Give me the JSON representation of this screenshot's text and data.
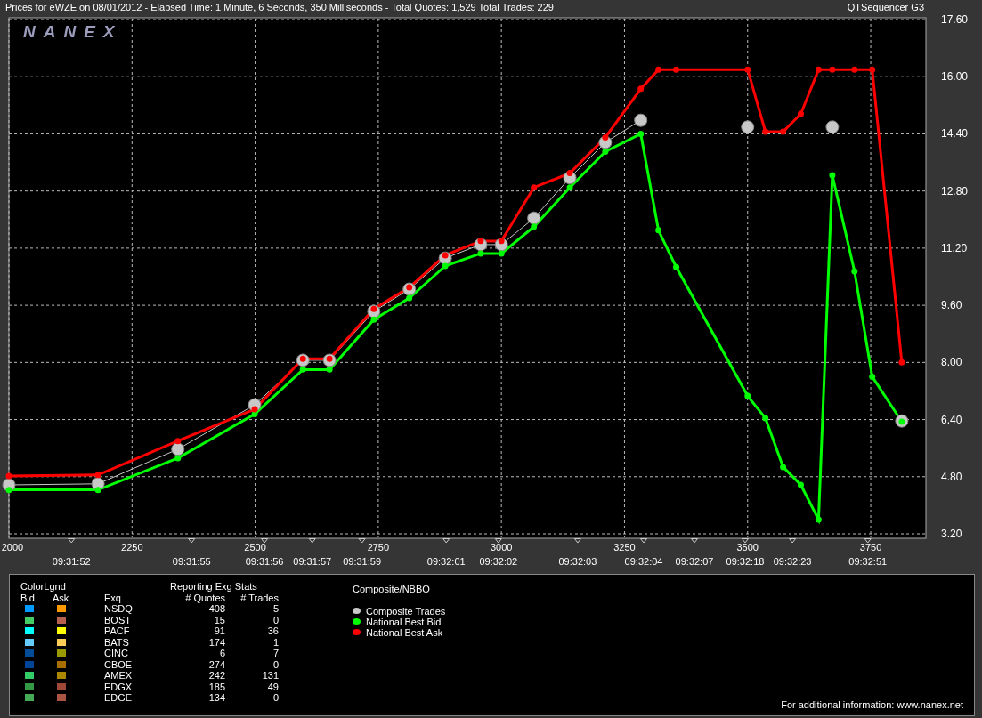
{
  "header": {
    "title": "Prices for  eWZE  on  08/01/2012  -  Elapsed Time: 1 Minute, 6 Seconds, 350 Milliseconds  -  Total Quotes: 1,529  Total Trades: 229",
    "app": "QTSequencer G3"
  },
  "chart": {
    "logo": "NANEX",
    "chart_data": {
      "type": "line",
      "grid": true,
      "xlim": [
        2000,
        3862
      ],
      "ylim": [
        3.2,
        17.6
      ],
      "xticks": [
        2000,
        2250,
        2500,
        2750,
        3000,
        3250,
        3500,
        3750
      ],
      "yticks": [
        {
          "value": 3.2,
          "label": "3.20"
        },
        {
          "value": 4.8,
          "label": "4.80"
        },
        {
          "value": 6.4,
          "label": "6.40"
        },
        {
          "value": 8,
          "label": "8.00"
        },
        {
          "value": 9.6,
          "label": "9.60"
        },
        {
          "value": 11.2,
          "label": "11.20"
        },
        {
          "value": 12.8,
          "label": "12.80"
        },
        {
          "value": 14.4,
          "label": "14.40"
        },
        {
          "value": 16,
          "label": "16.00"
        },
        {
          "value": 17.6,
          "label": "17.60"
        }
      ],
      "x": [
        2000,
        2181,
        2343,
        2499,
        2597,
        2651,
        2741,
        2813,
        2886,
        2958,
        3000,
        3066,
        3139,
        3211,
        3283,
        3319,
        3355,
        3500,
        3536,
        3572,
        3608,
        3644,
        3672,
        3717,
        3753,
        3813
      ],
      "series": [
        {
          "name": "Composite Trades",
          "color": "#c8c8c8",
          "marker": "circle",
          "values": [
            4.57,
            4.6,
            5.57,
            6.81,
            8.06,
            8.06,
            9.43,
            10.05,
            10.92,
            11.3,
            11.3,
            12.04,
            13.17,
            14.16,
            14.78,
            null,
            null,
            14.59,
            null,
            null,
            null,
            null,
            14.59,
            null,
            null,
            6.36
          ]
        },
        {
          "name": "National Best Bid",
          "color": "#00ff00",
          "marker": "circle",
          "values": [
            4.43,
            4.43,
            5.32,
            6.55,
            7.8,
            7.8,
            9.2,
            9.8,
            10.7,
            11.05,
            11.05,
            11.8,
            12.9,
            13.9,
            14.4,
            11.7,
            10.67,
            7.06,
            6.44,
            5.07,
            4.57,
            3.6,
            13.24,
            10.55,
            7.6,
            6.34
          ]
        },
        {
          "name": "National Best Ask",
          "color": "#ff0000",
          "marker": "circle",
          "values": [
            4.82,
            4.85,
            5.8,
            6.69,
            8.1,
            8.1,
            9.5,
            10.1,
            11.0,
            11.4,
            11.4,
            12.9,
            13.3,
            14.3,
            15.66,
            16.2,
            16.2,
            16.2,
            14.46,
            14.46,
            14.96,
            16.2,
            16.2,
            16.2,
            16.2,
            8.0
          ]
        }
      ],
      "annotations": [
        "09:31:52",
        "09:31:55",
        "09:31:56",
        "09:31:57",
        "09:31:59",
        "09:32:01",
        "09:32:02",
        "09:32:03",
        "09:32:04",
        "09:32:07",
        "09:32:18",
        "09:32:23",
        "09:32:51"
      ]
    }
  },
  "legend": {
    "title": "ColorLgnd",
    "bid_heading": "Bid",
    "ask_heading": "Ask",
    "exchange_heading": "Exq",
    "stats_title": "Reporting Exg Stats",
    "quotes_heading": "# Quotes",
    "trades_heading": "# Trades",
    "nbbo_title": "Composite/NBBO",
    "exchanges": [
      {
        "bid": {
          "color": "#0099ff"
        },
        "ask": {
          "color": "#ff9900"
        },
        "name": "NSDQ",
        "quotes": "408",
        "trades": "5"
      },
      {
        "bid": {
          "color": "#44cc66"
        },
        "ask": {
          "color": "#b86050"
        },
        "name": "BOST",
        "quotes": "15",
        "trades": "0"
      },
      {
        "bid": {
          "color": "#00ffff"
        },
        "ask": {
          "color": "#ffff00"
        },
        "name": "PACF",
        "quotes": "91",
        "trades": "36"
      },
      {
        "bid": {
          "color": "#66ccff"
        },
        "ask": {
          "color": "#ffcc55"
        },
        "name": "BATS",
        "quotes": "174",
        "trades": "1"
      },
      {
        "bid": {
          "color": "#004c99"
        },
        "ask": {
          "color": "#999900"
        },
        "name": "CINC",
        "quotes": "6",
        "trades": "7"
      },
      {
        "bid": {
          "color": "#004499"
        },
        "ask": {
          "color": "#a86f00"
        },
        "name": "CBOE",
        "quotes": "274",
        "trades": "0"
      },
      {
        "bid": {
          "color": "#33cc66"
        },
        "ask": {
          "color": "#aa8800"
        },
        "name": "AMEX",
        "quotes": "242",
        "trades": "131"
      },
      {
        "bid": {
          "color": "#339944"
        },
        "ask": {
          "color": "#a04838"
        },
        "name": "EDGX",
        "quotes": "185",
        "trades": "49"
      },
      {
        "bid": {
          "color": "#44aa55"
        },
        "ask": {
          "color": "#aa5544"
        },
        "name": "EDGE",
        "quotes": "134",
        "trades": "0"
      }
    ],
    "footer": "For additional information: www.nanex.net"
  }
}
